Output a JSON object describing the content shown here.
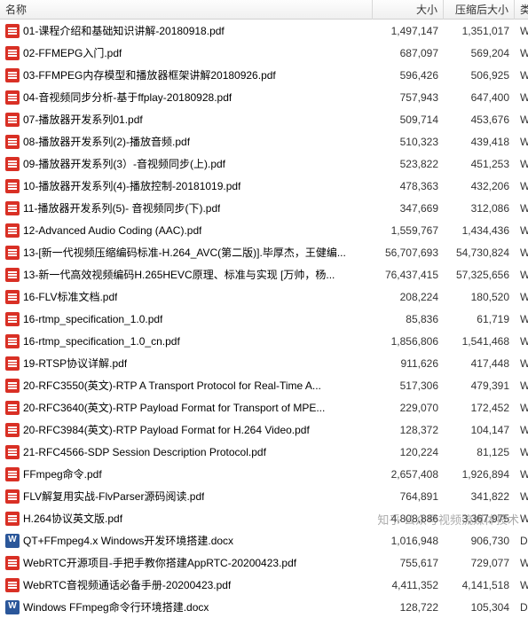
{
  "columns": {
    "name": "名称",
    "size": "大小",
    "compressed": "压缩后大小",
    "type": "类型"
  },
  "files": [
    {
      "icon": "pdf",
      "name": "01-课程介绍和基础知识讲解-20180918.pdf",
      "size": "1,497,147",
      "csize": "1,351,017",
      "type": "WPS P"
    },
    {
      "icon": "pdf",
      "name": "02-FFMEPG入门.pdf",
      "size": "687,097",
      "csize": "569,204",
      "type": "WPS P"
    },
    {
      "icon": "pdf",
      "name": "03-FFMPEG内存模型和播放器框架讲解20180926.pdf",
      "size": "596,426",
      "csize": "506,925",
      "type": "WPS P"
    },
    {
      "icon": "pdf",
      "name": "04-音视频同步分析-基于ffplay-20180928.pdf",
      "size": "757,943",
      "csize": "647,400",
      "type": "WPS P"
    },
    {
      "icon": "pdf",
      "name": "07-播放器开发系列01.pdf",
      "size": "509,714",
      "csize": "453,676",
      "type": "WPS P"
    },
    {
      "icon": "pdf",
      "name": "08-播放器开发系列(2)-播放音频.pdf",
      "size": "510,323",
      "csize": "439,418",
      "type": "WPS P"
    },
    {
      "icon": "pdf",
      "name": "09-播放器开发系列(3）-音视频同步(上).pdf",
      "size": "523,822",
      "csize": "451,253",
      "type": "WPS P"
    },
    {
      "icon": "pdf",
      "name": "10-播放器开发系列(4)-播放控制-20181019.pdf",
      "size": "478,363",
      "csize": "432,206",
      "type": "WPS P"
    },
    {
      "icon": "pdf",
      "name": "11-播放器开发系列(5)- 音视频同步(下).pdf",
      "size": "347,669",
      "csize": "312,086",
      "type": "WPS P"
    },
    {
      "icon": "pdf",
      "name": "12-Advanced Audio Coding (AAC).pdf",
      "size": "1,559,767",
      "csize": "1,434,436",
      "type": "WPS P"
    },
    {
      "icon": "pdf",
      "name": "13-[新一代视频压缩编码标准-H.264_AVC(第二版)].毕厚杰，王健编...",
      "size": "56,707,693",
      "csize": "54,730,824",
      "type": "WPS P"
    },
    {
      "icon": "pdf",
      "name": "13-新一代高效视频编码H.265HEVC原理、标准与实现 [万帅，杨...",
      "size": "76,437,415",
      "csize": "57,325,656",
      "type": "WPS P"
    },
    {
      "icon": "pdf",
      "name": "16-FLV标准文档.pdf",
      "size": "208,224",
      "csize": "180,520",
      "type": "WPS P"
    },
    {
      "icon": "pdf",
      "name": "16-rtmp_specification_1.0.pdf",
      "size": "85,836",
      "csize": "61,719",
      "type": "WPS P"
    },
    {
      "icon": "pdf",
      "name": "16-rtmp_specification_1.0_cn.pdf",
      "size": "1,856,806",
      "csize": "1,541,468",
      "type": "WPS P"
    },
    {
      "icon": "pdf",
      "name": "19-RTSP协议详解.pdf",
      "size": "911,626",
      "csize": "417,448",
      "type": "WPS P"
    },
    {
      "icon": "pdf",
      "name": "20-RFC3550(英文)-RTP A Transport Protocol for Real-Time A...",
      "size": "517,306",
      "csize": "479,391",
      "type": "WPS P"
    },
    {
      "icon": "pdf",
      "name": "20-RFC3640(英文)-RTP Payload Format for Transport of MPE...",
      "size": "229,070",
      "csize": "172,452",
      "type": "WPS P"
    },
    {
      "icon": "pdf",
      "name": "20-RFC3984(英文)-RTP Payload Format for H.264 Video.pdf",
      "size": "128,372",
      "csize": "104,147",
      "type": "WPS P"
    },
    {
      "icon": "pdf",
      "name": "21-RFC4566-SDP Session  Description  Protocol.pdf",
      "size": "120,224",
      "csize": "81,125",
      "type": "WPS P"
    },
    {
      "icon": "pdf",
      "name": "FFmpeg命令.pdf",
      "size": "2,657,408",
      "csize": "1,926,894",
      "type": "WPS P"
    },
    {
      "icon": "pdf",
      "name": "FLV解复用实战-FlvParser源码阅读.pdf",
      "size": "764,891",
      "csize": "341,822",
      "type": "WPS P"
    },
    {
      "icon": "pdf",
      "name": "H.264协议英文版.pdf",
      "size": "4,808,886",
      "csize": "3,367,975",
      "type": "WPS P"
    },
    {
      "icon": "docx",
      "name": "QT+FFmpeg4.x Windows开发环境搭建.docx",
      "size": "1,016,948",
      "csize": "906,730",
      "type": "DOCX"
    },
    {
      "icon": "pdf",
      "name": "WebRTC开源项目-手把手教你搭建AppRTC-20200423.pdf",
      "size": "755,617",
      "csize": "729,077",
      "type": "WPS P"
    },
    {
      "icon": "pdf",
      "name": "WebRTC音视频通话必备手册-20200423.pdf",
      "size": "4,411,352",
      "csize": "4,141,518",
      "type": "WPS P"
    },
    {
      "icon": "docx",
      "name": "Windows FFmpeg命令行环境搭建.docx",
      "size": "128,722",
      "csize": "105,304",
      "type": "DOCX"
    }
  ],
  "watermark": "知乎 公众号视频流媒体技术"
}
